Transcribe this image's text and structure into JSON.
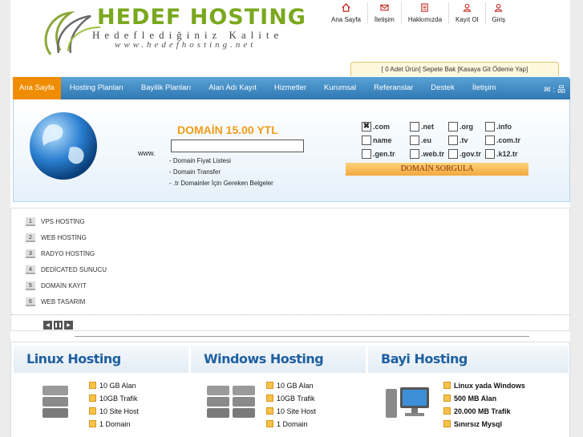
{
  "brand": {
    "title": "HEDEF HOSTING",
    "slogan": "Hedeflediğiniz Kalite",
    "url": "www.hedefhosting.net"
  },
  "top_nav": [
    {
      "label": "Ana Sayfa",
      "icon": "home-icon"
    },
    {
      "label": "İletişim",
      "icon": "mail-icon"
    },
    {
      "label": "Hakkımızda",
      "icon": "document-icon"
    },
    {
      "label": "Kayıt Ol",
      "icon": "user-add-icon"
    },
    {
      "label": "Giriş",
      "icon": "user-icon"
    }
  ],
  "cart": {
    "text": "[ 0  Adet Ürün] Sepete Bak  [Kasaya Git Ödeme Yap]"
  },
  "main_nav": [
    "Ana Sayfa",
    "Hosting Planları",
    "Bayilik Planları",
    "Alan Adı Kayıt",
    "Hizmetler",
    "Kurumsal",
    "Referanslar",
    "Destek",
    "İletişim"
  ],
  "main_nav_icons": "✉ : 品",
  "domain_search": {
    "title": "DOMAİN 15.00 YTL",
    "prefix": "www.",
    "input_value": "",
    "links": [
      "- Domain Fiyat Listesi",
      "- Domain Transfer",
      "- .tr Domainler İçin Gereken Belgeler"
    ],
    "tlds": [
      {
        "label": ".com",
        "checked": true
      },
      {
        "label": ".net",
        "checked": false
      },
      {
        "label": ".org",
        "checked": false
      },
      {
        "label": ".info",
        "checked": false
      },
      {
        "label": "name",
        "checked": false
      },
      {
        "label": ".eu",
        "checked": false
      },
      {
        "label": ".tv",
        "checked": false
      },
      {
        "label": ".com.tr",
        "checked": false
      },
      {
        "label": ".gen.tr",
        "checked": false
      },
      {
        "label": ".web.tr",
        "checked": false
      },
      {
        "label": ".gov.tr",
        "checked": false
      },
      {
        "label": ".k12.tr",
        "checked": false
      }
    ],
    "button_label": "DOMAİN SORGULA"
  },
  "services": [
    {
      "num": "1",
      "label": "VPS HOSTİNG"
    },
    {
      "num": "2",
      "label": "WEB HOSTİNG"
    },
    {
      "num": "3",
      "label": "RADYO HOSTİNG"
    },
    {
      "num": "4",
      "label": "DEDİCATED SUNUCU"
    },
    {
      "num": "5",
      "label": "DOMAİN KAYIT"
    },
    {
      "num": "6",
      "label": "WEB TASARIM"
    }
  ],
  "hosting_plans": [
    {
      "title": "Linux Hosting",
      "features": [
        "10 GB Alan",
        "10GB Trafik",
        "10 Site Host",
        "1 Domain"
      ]
    },
    {
      "title": "Windows Hosting",
      "features": [
        "10 GB Alan",
        "10GB Trafik",
        "10 Site Host",
        "1 Domain"
      ]
    },
    {
      "title": "Bayi Hosting",
      "features": [
        "Linux yada Windows",
        "500 MB Alan",
        "20.000 MB Trafik",
        "Sınırsız Mysql"
      ]
    }
  ]
}
